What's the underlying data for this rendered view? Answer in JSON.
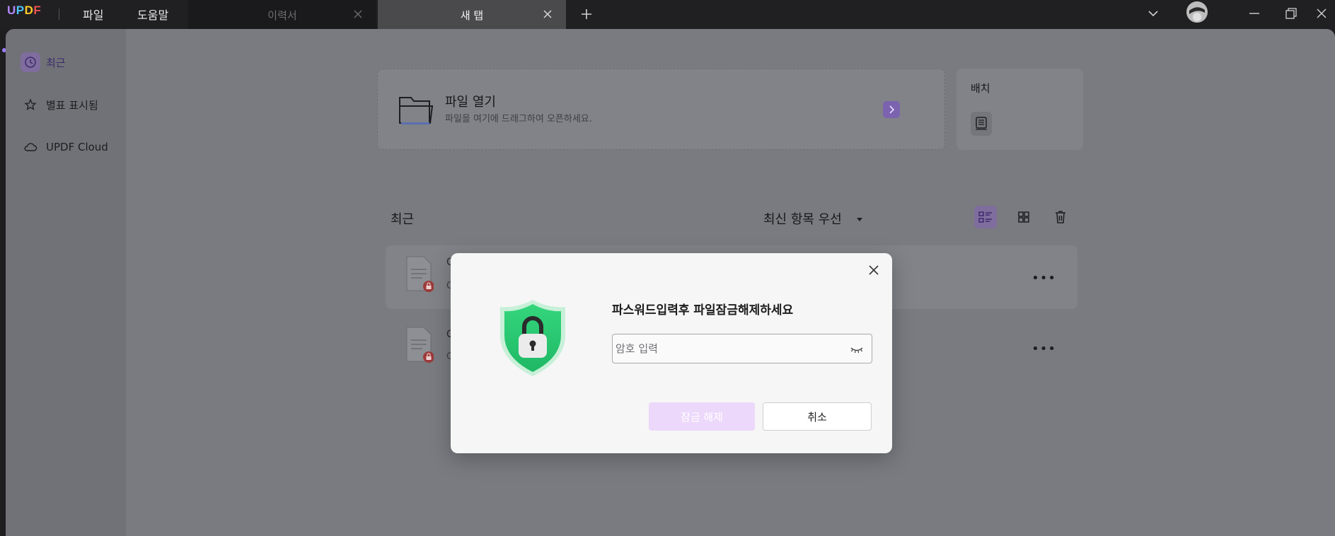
{
  "app": {
    "logo": {
      "u": "U",
      "p": "P",
      "d": "D",
      "f": "F"
    }
  },
  "menu": {
    "file": "파일",
    "help": "도움말"
  },
  "tabs": [
    {
      "label": "이력서"
    },
    {
      "label": "새 탭"
    }
  ],
  "sidebar": {
    "items": [
      {
        "label": "최근",
        "icon": "clock-icon"
      },
      {
        "label": "별표 표시됨",
        "icon": "star-icon"
      },
      {
        "label": "UPDF Cloud",
        "icon": "cloud-icon"
      }
    ]
  },
  "open_file": {
    "title": "파일 열기",
    "subtitle": "파일을 여기에 드래그하여 오픈하세요."
  },
  "batch": {
    "label": "배치"
  },
  "recent": {
    "title": "최근",
    "sort": "최신 항목 우선"
  },
  "files": [
    {
      "name": "C",
      "meta": "C"
    },
    {
      "name": "C",
      "meta": "C"
    }
  ],
  "dialog": {
    "title": "파스워드입력후 파일잠금해제하세요",
    "password_placeholder": "암호 입력",
    "unlock_label": "잠금 해제",
    "cancel_label": "취소"
  },
  "colors": {
    "accent": "#7b63b0",
    "unlock_disabled": "#ecd8fb",
    "shield": "#2ecc71"
  }
}
